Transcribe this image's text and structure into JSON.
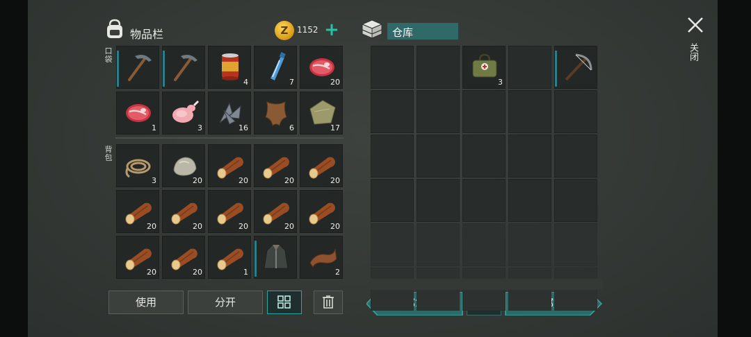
{
  "inventory": {
    "title": "物品栏",
    "coins": "1152",
    "pocket_label": "口袋",
    "backpack_label": "背包",
    "pocket_slots": [
      {
        "item": "pickaxe-icon",
        "qty": "",
        "durability": true
      },
      {
        "item": "pickaxe-icon",
        "qty": "",
        "durability": true
      },
      {
        "item": "canned-food-icon",
        "qty": "4",
        "durability": false
      },
      {
        "item": "water-bottle-icon",
        "qty": "7",
        "durability": false
      },
      {
        "item": "raw-meat-icon",
        "qty": "20",
        "durability": false
      },
      {
        "item": "raw-meat-icon",
        "qty": "1",
        "durability": false
      },
      {
        "item": "raw-chicken-icon",
        "qty": "3",
        "durability": false
      },
      {
        "item": "scrap-metal-icon",
        "qty": "16",
        "durability": false
      },
      {
        "item": "leather-hide-icon",
        "qty": "6",
        "durability": false
      },
      {
        "item": "cloth-icon",
        "qty": "17",
        "durability": false
      }
    ],
    "backpack_slots": [
      {
        "item": "rope-icon",
        "qty": "3",
        "durability": false
      },
      {
        "item": "stone-icon",
        "qty": "20",
        "durability": false
      },
      {
        "item": "wood-log-icon",
        "qty": "20",
        "durability": false
      },
      {
        "item": "wood-log-icon",
        "qty": "20",
        "durability": false
      },
      {
        "item": "wood-log-icon",
        "qty": "20",
        "durability": false
      },
      {
        "item": "wood-log-icon",
        "qty": "20",
        "durability": false
      },
      {
        "item": "wood-log-icon",
        "qty": "20",
        "durability": false
      },
      {
        "item": "wood-log-icon",
        "qty": "20",
        "durability": false
      },
      {
        "item": "wood-log-icon",
        "qty": "20",
        "durability": false
      },
      {
        "item": "wood-log-icon",
        "qty": "20",
        "durability": false
      },
      {
        "item": "wood-log-icon",
        "qty": "20",
        "durability": false
      },
      {
        "item": "wood-log-icon",
        "qty": "20",
        "durability": false
      },
      {
        "item": "wood-log-icon",
        "qty": "1",
        "durability": false
      },
      {
        "item": "jacket-icon",
        "qty": "",
        "durability": true
      },
      {
        "item": "leather-strip-icon",
        "qty": "2",
        "durability": false
      }
    ],
    "buttons": {
      "use": "使用",
      "split": "分开"
    }
  },
  "warehouse": {
    "title": "仓库",
    "slots": [
      {
        "item": "",
        "qty": ""
      },
      {
        "item": "",
        "qty": ""
      },
      {
        "item": "medkit-bag-icon",
        "qty": "3"
      },
      {
        "item": "",
        "qty": ""
      },
      {
        "item": "crossbow-icon",
        "qty": "",
        "durability": true
      }
    ],
    "take_all": "全部拿上",
    "put_all": "全部放入"
  },
  "close_label": "关闭",
  "colors": {
    "accent": "#2f6a68",
    "accent_border": "#2aa9a0",
    "plus": "#27c2a3",
    "coin": "#e0a820"
  }
}
